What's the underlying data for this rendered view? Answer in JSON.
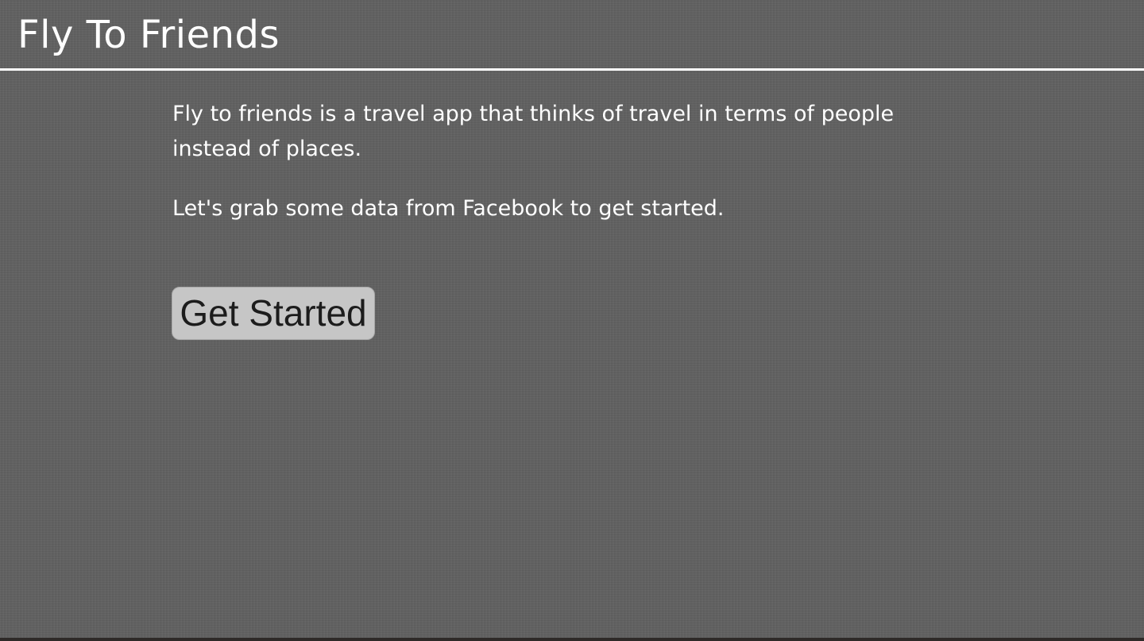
{
  "header": {
    "title": "Fly To Friends"
  },
  "main": {
    "intro_text": "Fly to friends is a travel app that thinks of travel in terms of people instead of places.",
    "cta_text": "Let's grab some data from Facebook to get started.",
    "get_started_label": "Get Started"
  },
  "colors": {
    "background": "#616161",
    "header_rule": "#ffffff",
    "button_background": "#c6c6c6",
    "button_text": "#1c1c1c"
  }
}
